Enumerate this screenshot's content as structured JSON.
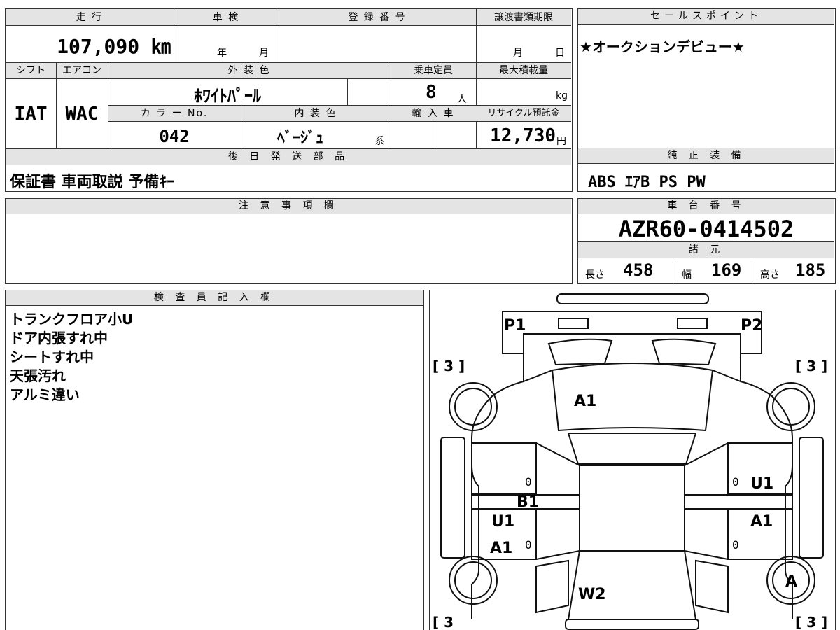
{
  "headers": {
    "mileage": "走 行",
    "inspection": "車 検",
    "registration": "登 録 番 号",
    "transfer_deadline": "譲渡書類期限",
    "sales_point": "セールスポイント",
    "shift": "シフト",
    "aircon": "エアコン",
    "exterior_color": "外 装 色",
    "capacity": "乗車定員",
    "max_load": "最大積載量",
    "color_no": "カ ラ ー No.",
    "interior_color": "内 装 色",
    "import": "輸 入 車",
    "recycle": "リサイクル預託金",
    "later_parts": "後 日 発 送 部 品",
    "genuine_equipment": "純 正 装 備",
    "notes": "注 意 事 項 欄",
    "chassis_no": "車 台 番 号",
    "specs": "諸 元",
    "inspector": "検 査 員 記 入 欄"
  },
  "values": {
    "mileage": "107,090 ㎞",
    "inspection_year": "年",
    "inspection_month": "月",
    "deadline_month": "月",
    "deadline_day": "日",
    "sales_point": "★オークションデビュー★",
    "shift": "IAT",
    "aircon": "WAC",
    "exterior_color": "ﾎﾜｲﾄﾊﾟｰﾙ",
    "capacity": "8",
    "capacity_unit": "人",
    "max_load_unit": "kg",
    "color_no": "042",
    "interior_color": "ﾍﾞｰｼﾞｭ",
    "interior_suffix": "系",
    "recycle": "12,730",
    "recycle_unit": "円",
    "later_parts": "保証書 車両取説 予備ｷｰ",
    "genuine_equipment": "ABS ｴｱB PS PW",
    "chassis_no": "AZR60-0414502",
    "length_label": "長さ",
    "length": "458",
    "width_label": "幅",
    "width": "169",
    "height_label": "高さ",
    "height": "185"
  },
  "inspector_notes": [
    "トランクフロア小U",
    "ドア内張すれ中",
    "シートすれ中",
    "天張汚れ",
    "アルミ違い"
  ],
  "diagram": {
    "p1": "P1",
    "p2": "P2",
    "tire_tl": "[ 3 ]",
    "tire_tr": "[ 3 ]",
    "tire_bl": "[ 3",
    "tire_br": "[ 3 ]",
    "roof": "A1",
    "left_door_top": "B1",
    "left_door_u": "U1",
    "left_door_a": "A1",
    "right_front_u": "U1",
    "right_rear_a": "A1",
    "tail": "W2",
    "rear_right_wheel": "A",
    "zero1": "0",
    "zero2": "0",
    "zero3": "0",
    "zero4": "0"
  }
}
